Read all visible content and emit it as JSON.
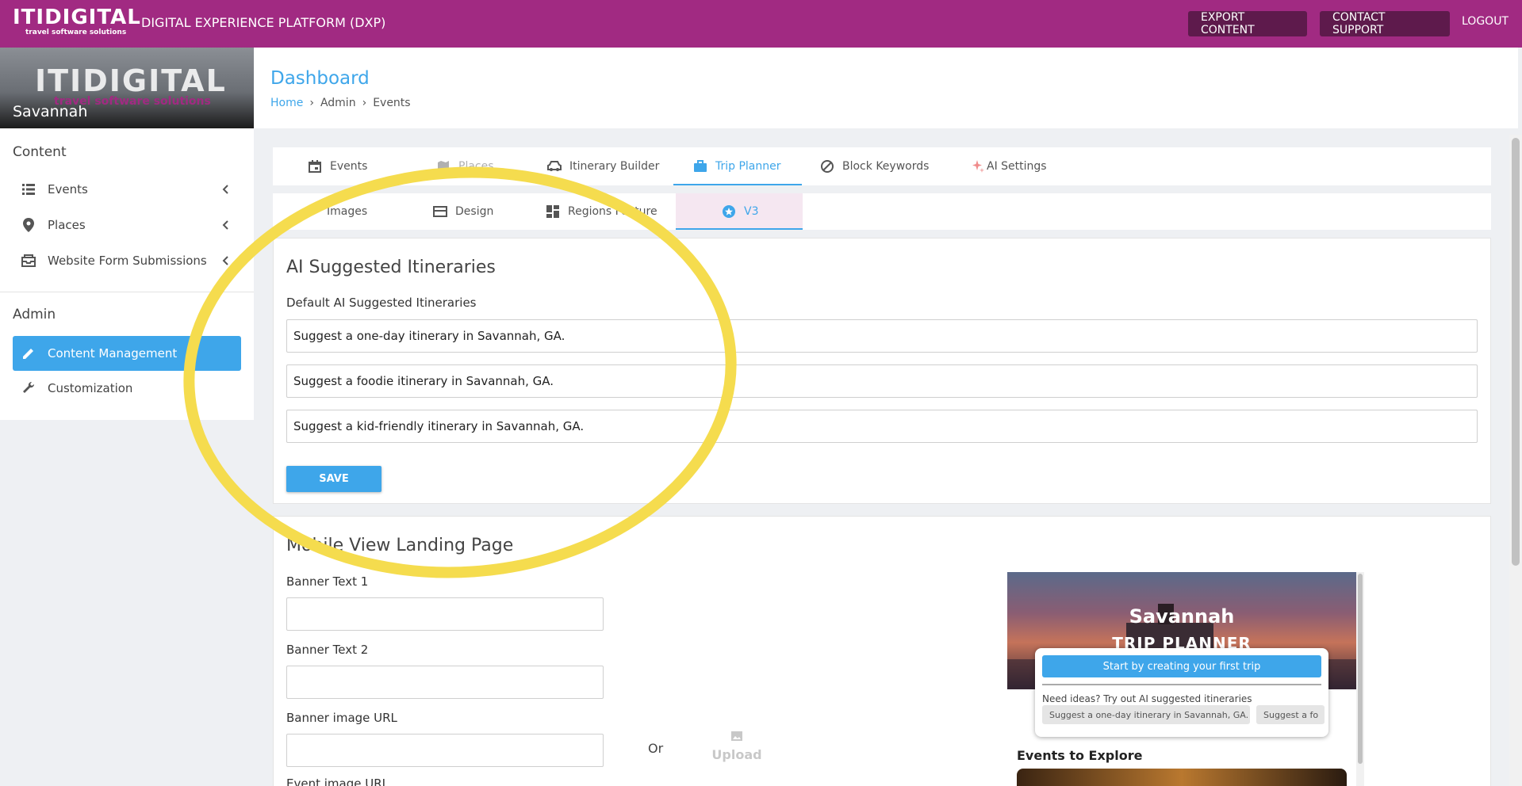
{
  "topbar": {
    "logo_text": "ITIDIGITAL",
    "logo_sub": "travel software solutions",
    "app_title": "DIGITAL EXPERIENCE PLATFORM (DXP)",
    "export_label": "EXPORT CONTENT",
    "support_label": "CONTACT SUPPORT",
    "logout_label": "LOGOUT",
    "color": "#a12a82"
  },
  "sidebar": {
    "logo_text": "ITIDIGITAL",
    "logo_sub": "travel software solutions",
    "city": "Savannah",
    "content_section": "Content",
    "admin_section": "Admin",
    "items": [
      {
        "label": "Events",
        "icon": "list-icon"
      },
      {
        "label": "Places",
        "icon": "location-pin-icon"
      },
      {
        "label": "Website Form Submissions",
        "icon": "inbox-icon"
      }
    ],
    "admin_items": [
      {
        "label": "Content Management",
        "icon": "pencil-icon",
        "active": true
      },
      {
        "label": "Customization",
        "icon": "wrench-icon"
      }
    ]
  },
  "header": {
    "title": "Dashboard",
    "breadcrumb": [
      "Home",
      "Admin",
      "Events"
    ]
  },
  "tabs_primary": [
    {
      "label": "Events",
      "icon": "calendar-icon"
    },
    {
      "label": "Places",
      "icon": "map-icon"
    },
    {
      "label": "Itinerary Builder",
      "icon": "car-icon"
    },
    {
      "label": "Trip Planner",
      "icon": "briefcase-icon",
      "active": true
    },
    {
      "label": "Block Keywords",
      "icon": "block-icon"
    },
    {
      "label": "AI Settings",
      "icon": "sparkle-icon"
    }
  ],
  "tabs_secondary": [
    {
      "label": "Images",
      "icon": "wrench-icon"
    },
    {
      "label": "Design",
      "icon": "card-icon"
    },
    {
      "label": "Regions Feature",
      "icon": "dashboard-icon"
    },
    {
      "label": "V3",
      "icon": "star-circle-icon",
      "active": true
    }
  ],
  "ai_section": {
    "title": "AI Suggested Itineraries",
    "field_label": "Default AI Suggested Itineraries",
    "itineraries": [
      "Suggest a one-day itinerary in Savannah, GA.",
      "Suggest a foodie itinerary in Savannah, GA.",
      "Suggest a kid-friendly itinerary in Savannah, GA."
    ],
    "save_label": "SAVE"
  },
  "mobile_section": {
    "title": "Mobile View Landing Page",
    "banner_text_1_label": "Banner Text 1",
    "banner_text_2_label": "Banner Text 2",
    "banner_image_label": "Banner image URL",
    "event_image_label": "Event image URL",
    "or_label": "Or",
    "upload_label": "Upload"
  },
  "preview": {
    "city": "Savannah",
    "subtitle": "TRIP PLANNER",
    "start_button": "Start by creating your first trip",
    "ideas_text": "Need ideas? Try out AI suggested itineraries",
    "chips": [
      "Suggest a one-day itinerary in Savannah, GA.",
      "Suggest a fo"
    ],
    "events_heading": "Events to Explore"
  },
  "colors": {
    "accent": "#3ea6ea",
    "brand": "#a12a82",
    "annotation": "#f5dc4e"
  }
}
